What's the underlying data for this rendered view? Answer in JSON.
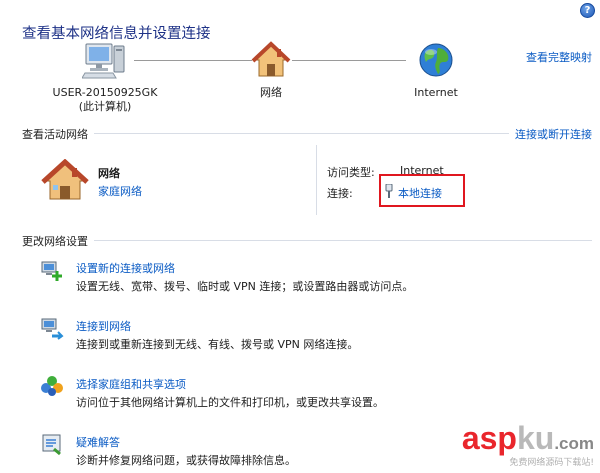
{
  "help": {
    "label": "?"
  },
  "header": {
    "title": "查看基本网络信息并设置连接",
    "full_map_link": "查看完整映射"
  },
  "network_map": {
    "computer_name": "USER-20150925GK",
    "computer_sub": "(此计算机)",
    "network_label": "网络",
    "internet_label": "Internet"
  },
  "active_networks": {
    "title": "查看活动网络",
    "connect_link": "连接或断开连接",
    "network_name": "网络",
    "network_type": "家庭网络",
    "access_type_label": "访问类型:",
    "access_type_value": "Internet",
    "connection_label": "连接:",
    "connection_value": "本地连接",
    "highlight_color": "#e0171f"
  },
  "change_settings": {
    "title": "更改网络设置",
    "tasks": [
      {
        "icon": "new-connection-icon",
        "link": "设置新的连接或网络",
        "desc": "设置无线、宽带、拨号、临时或 VPN 连接；或设置路由器或访问点。"
      },
      {
        "icon": "connect-network-icon",
        "link": "连接到网络",
        "desc": "连接到或重新连接到无线、有线、拨号或 VPN 网络连接。"
      },
      {
        "icon": "homegroup-icon",
        "link": "选择家庭组和共享选项",
        "desc": "访问位于其他网络计算机上的文件和打印机，或更改共享设置。"
      },
      {
        "icon": "troubleshoot-icon",
        "link": "疑难解答",
        "desc": "诊断并修复网络问题，或获得故障排除信息。"
      }
    ]
  },
  "watermark": {
    "main_a": "asp",
    "main_b": "ku",
    "main_c": ".com",
    "sub": "免费网络源码下载站!"
  },
  "colors": {
    "link": "#0a5bc4",
    "title": "#1e3287",
    "accent": "#e9262c"
  }
}
